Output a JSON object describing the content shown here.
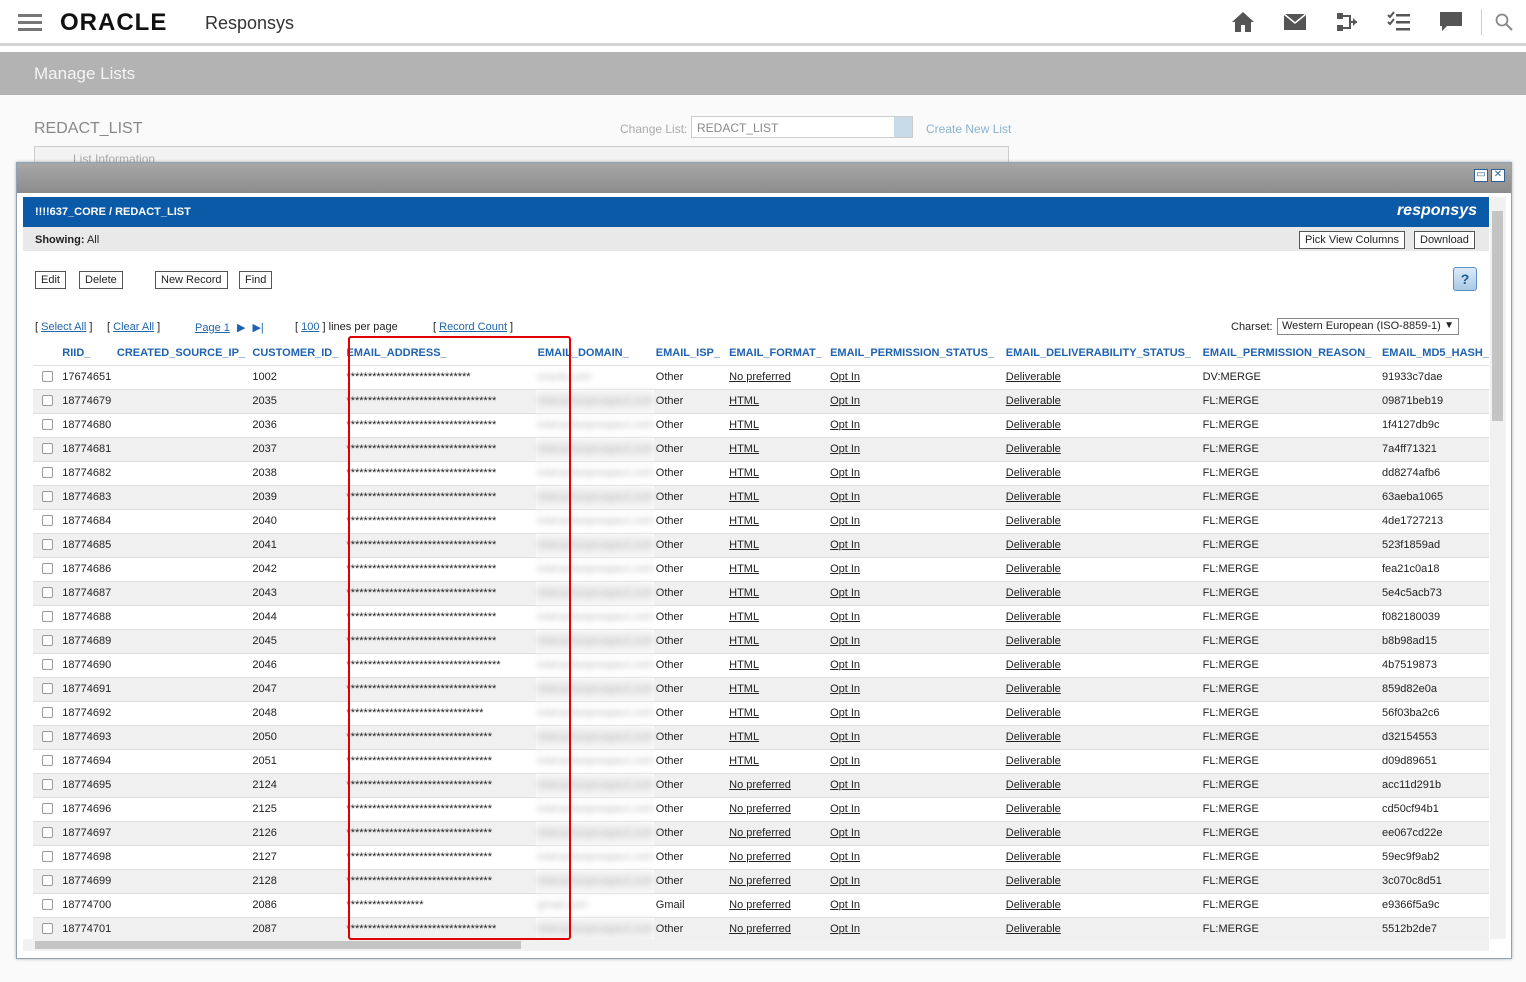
{
  "header": {
    "brand": "ORACLE",
    "product": "Responsys",
    "icons": [
      "home-icon",
      "mail-icon",
      "flow-icon",
      "checklist-icon",
      "chat-icon",
      "search-icon"
    ]
  },
  "band": {
    "title": "Manage Lists"
  },
  "list": {
    "name": "REDACT_LIST",
    "change_label": "Change List:",
    "change_value": "REDACT_LIST",
    "create_link": "Create New List",
    "info_label": "List Information"
  },
  "popup": {
    "title": "!!!!637_CORE / REDACT_LIST",
    "logo": "responsys",
    "showing_label": "Showing:",
    "showing_value": "All",
    "pick_columns": "Pick View Columns",
    "download": "Download",
    "edit": "Edit",
    "delete": "Delete",
    "new_record": "New Record",
    "find": "Find",
    "help": "?",
    "select_all": "Select All",
    "clear_all": "Clear All",
    "page": "Page 1",
    "lines": "100",
    "lines_suffix": "lines per page",
    "record_count": "Record Count",
    "charset_label": "Charset:",
    "charset_value": "Western European (ISO-8859-1)"
  },
  "table": {
    "columns": [
      "RIID_",
      "CREATED_SOURCE_IP_",
      "CUSTOMER_ID_",
      "EMAIL_ADDRESS_",
      "EMAIL_DOMAIN_",
      "EMAIL_ISP_",
      "EMAIL_FORMAT_",
      "EMAIL_PERMISSION_STATUS_",
      "EMAIL_DELIVERABILITY_STATUS_",
      "EMAIL_PERMISSION_REASON_",
      "EMAIL_MD5_HASH_"
    ],
    "rows": [
      [
        "17674651",
        "",
        "1002",
        "*****************************",
        "oracle.com",
        "Other",
        "No preferred",
        "Opt In",
        "Deliverable",
        "DV:MERGE",
        "91933c7dae"
      ],
      [
        "18774679",
        "",
        "2035",
        "***********************************",
        "interactiveprospect.com",
        "Other",
        "HTML",
        "Opt In",
        "Deliverable",
        "FL:MERGE",
        "09871beb19"
      ],
      [
        "18774680",
        "",
        "2036",
        "***********************************",
        "interactiveprospect.com",
        "Other",
        "HTML",
        "Opt In",
        "Deliverable",
        "FL:MERGE",
        "1f4127db9c"
      ],
      [
        "18774681",
        "",
        "2037",
        "***********************************",
        "interactiveprospect.com",
        "Other",
        "HTML",
        "Opt In",
        "Deliverable",
        "FL:MERGE",
        "7a4ff71321"
      ],
      [
        "18774682",
        "",
        "2038",
        "***********************************",
        "interactiveprospect.com",
        "Other",
        "HTML",
        "Opt In",
        "Deliverable",
        "FL:MERGE",
        "dd8274afb6"
      ],
      [
        "18774683",
        "",
        "2039",
        "***********************************",
        "interactiveprospect.com",
        "Other",
        "HTML",
        "Opt In",
        "Deliverable",
        "FL:MERGE",
        "63aeba1065"
      ],
      [
        "18774684",
        "",
        "2040",
        "***********************************",
        "interactiveprospect.com",
        "Other",
        "HTML",
        "Opt In",
        "Deliverable",
        "FL:MERGE",
        "4de1727213"
      ],
      [
        "18774685",
        "",
        "2041",
        "***********************************",
        "interactiveprospect.com",
        "Other",
        "HTML",
        "Opt In",
        "Deliverable",
        "FL:MERGE",
        "523f1859ad"
      ],
      [
        "18774686",
        "",
        "2042",
        "***********************************",
        "interactiveprospect.com",
        "Other",
        "HTML",
        "Opt In",
        "Deliverable",
        "FL:MERGE",
        "fea21c0a18"
      ],
      [
        "18774687",
        "",
        "2043",
        "***********************************",
        "interactiveprospect.com",
        "Other",
        "HTML",
        "Opt In",
        "Deliverable",
        "FL:MERGE",
        "5e4c5acb73"
      ],
      [
        "18774688",
        "",
        "2044",
        "***********************************",
        "interactiveprospect.com",
        "Other",
        "HTML",
        "Opt In",
        "Deliverable",
        "FL:MERGE",
        "f082180039"
      ],
      [
        "18774689",
        "",
        "2045",
        "***********************************",
        "interactiveprospect.com",
        "Other",
        "HTML",
        "Opt In",
        "Deliverable",
        "FL:MERGE",
        "b8b98ad15"
      ],
      [
        "18774690",
        "",
        "2046",
        "************************************",
        "interactiveprospect.com",
        "Other",
        "HTML",
        "Opt In",
        "Deliverable",
        "FL:MERGE",
        "4b7519873"
      ],
      [
        "18774691",
        "",
        "2047",
        "***********************************",
        "interactiveprospect.com",
        "Other",
        "HTML",
        "Opt In",
        "Deliverable",
        "FL:MERGE",
        "859d82e0a"
      ],
      [
        "18774692",
        "",
        "2048",
        "********************************",
        "interactiveprospect.com",
        "Other",
        "HTML",
        "Opt In",
        "Deliverable",
        "FL:MERGE",
        "56f03ba2c6"
      ],
      [
        "18774693",
        "",
        "2050",
        "**********************************",
        "interactiveprospect.com",
        "Other",
        "HTML",
        "Opt In",
        "Deliverable",
        "FL:MERGE",
        "d32154553"
      ],
      [
        "18774694",
        "",
        "2051",
        "**********************************",
        "interactiveprospect.com",
        "Other",
        "HTML",
        "Opt In",
        "Deliverable",
        "FL:MERGE",
        "d09d89651"
      ],
      [
        "18774695",
        "",
        "2124",
        "**********************************",
        "interactiveprospect.com",
        "Other",
        "No preferred",
        "Opt In",
        "Deliverable",
        "FL:MERGE",
        "acc11d291b"
      ],
      [
        "18774696",
        "",
        "2125",
        "**********************************",
        "interactiveprospect.com",
        "Other",
        "No preferred",
        "Opt In",
        "Deliverable",
        "FL:MERGE",
        "cd50cf94b1"
      ],
      [
        "18774697",
        "",
        "2126",
        "**********************************",
        "interactiveprospect.com",
        "Other",
        "No preferred",
        "Opt In",
        "Deliverable",
        "FL:MERGE",
        "ee067cd22e"
      ],
      [
        "18774698",
        "",
        "2127",
        "**********************************",
        "interactiveprospect.com",
        "Other",
        "No preferred",
        "Opt In",
        "Deliverable",
        "FL:MERGE",
        "59ec9f9ab2"
      ],
      [
        "18774699",
        "",
        "2128",
        "**********************************",
        "interactiveprospect.com",
        "Other",
        "No preferred",
        "Opt In",
        "Deliverable",
        "FL:MERGE",
        "3c070c8d51"
      ],
      [
        "18774700",
        "",
        "2086",
        "******************",
        "gmail.com",
        "Gmail",
        "No preferred",
        "Opt In",
        "Deliverable",
        "FL:MERGE",
        "e9366f5a9c"
      ],
      [
        "18774701",
        "",
        "2087",
        "***********************************",
        "interactiveprospect.com",
        "Other",
        "No preferred",
        "Opt In",
        "Deliverable",
        "FL:MERGE",
        "5512b2de7"
      ]
    ]
  },
  "colors": {
    "header_blue": "#0a5aa8",
    "link_blue": "#2266aa",
    "highlight": "#e00000"
  }
}
